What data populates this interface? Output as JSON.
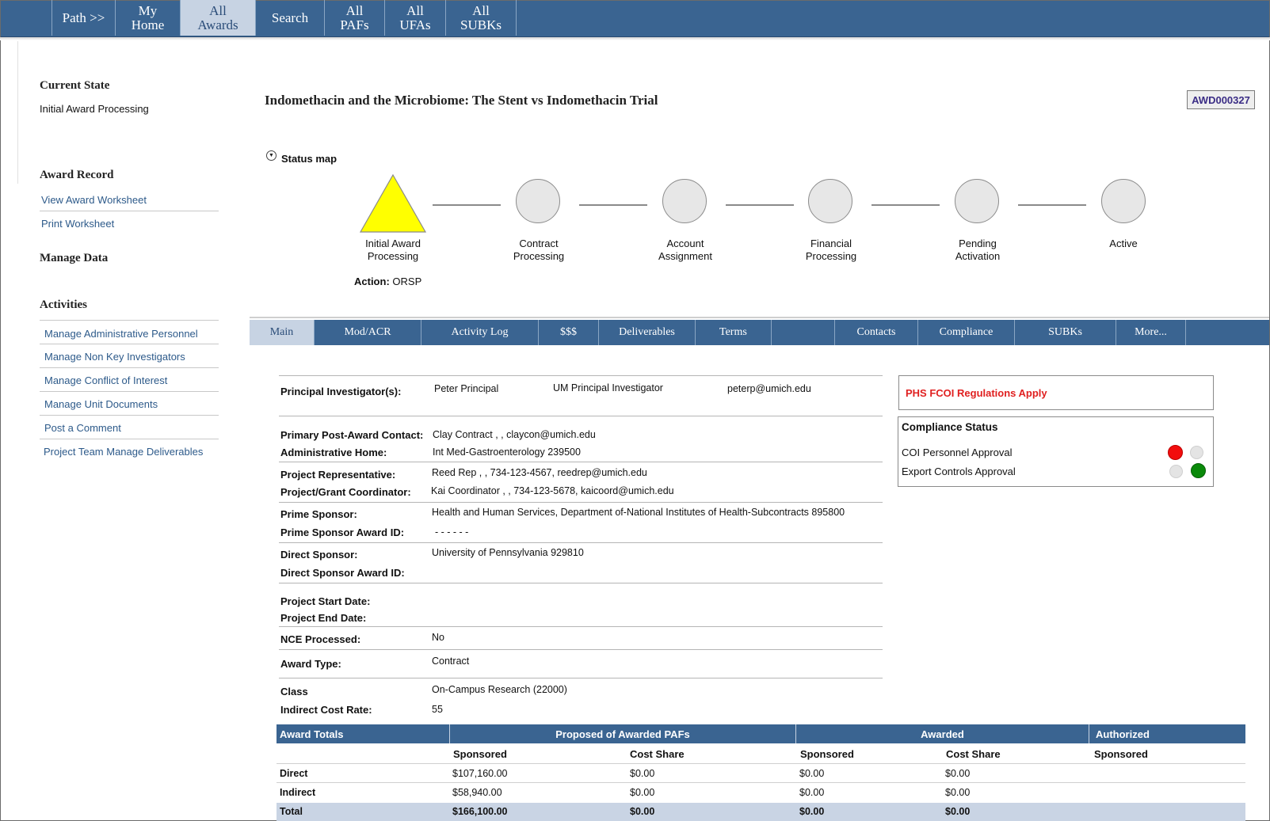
{
  "topnav": {
    "tabs": [
      {
        "label": "Path >>",
        "active": false
      },
      {
        "label": "My\nHome",
        "active": false
      },
      {
        "label": "All\nAwards",
        "active": true
      },
      {
        "label": "Search",
        "active": false
      },
      {
        "label": "All\nPAFs",
        "active": false
      },
      {
        "label": "All\nUFAs",
        "active": false
      },
      {
        "label": "All\nSUBKs",
        "active": false
      }
    ]
  },
  "sidebar": {
    "current_state_heading": "Current State",
    "current_state_value": "Initial Award Processing",
    "award_record_heading": "Award Record",
    "award_record_links": [
      "View Award Worksheet",
      "Print Worksheet"
    ],
    "manage_data_heading": "Manage Data",
    "activities_heading": "Activities",
    "activities_links": [
      "Manage Administrative Personnel",
      "Manage Non Key Investigators",
      "Manage Conflict of Interest",
      "Manage Unit Documents",
      "Post a Comment",
      "Project Team Manage Deliverables"
    ]
  },
  "header": {
    "title": "Indomethacin and the Microbiome: The Stent vs Indomethacin Trial",
    "award_id": "AWD000327"
  },
  "status_map": {
    "label": "Status map",
    "steps": [
      {
        "label": "Initial Award\nProcessing",
        "current": true
      },
      {
        "label": "Contract\nProcessing",
        "current": false
      },
      {
        "label": "Account\nAssignment",
        "current": false
      },
      {
        "label": "Financial\nProcessing",
        "current": false
      },
      {
        "label": "Pending\nActivation",
        "current": false
      },
      {
        "label": "Active",
        "current": false
      }
    ],
    "current_color": "#ffff00",
    "action_label": "Action:",
    "action_value": "ORSP"
  },
  "tabs": [
    "Main",
    "Mod/ACR",
    "Activity Log",
    "$$$",
    "Deliverables",
    "Terms",
    "Contacts",
    "Compliance",
    "SUBKs",
    "More..."
  ],
  "active_tab": "Main",
  "main": {
    "pi_label": "Principal Investigator(s):",
    "pi_name": "Peter Principal",
    "pi_role": "UM Principal Investigator",
    "pi_email": "peterp@umich.edu",
    "post_award_label": "Primary Post-Award Contact:",
    "post_award_value": "Clay Contract  ,  ,  claycon@umich.edu",
    "admin_home_label": "Administrative Home:",
    "admin_home_value": "Int Med-Gastroenterology   239500",
    "proj_rep_label": "Project Representative:",
    "proj_rep_value": "Reed Rep  ,  ,  734-123-4567,   reedrep@umich.edu",
    "proj_coord_label": "Project/Grant Coordinator:",
    "proj_coord_value": "Kai Coordinator  ,  ,  734-123-5678,   kaicoord@umich.edu",
    "prime_sponsor_label": "Prime Sponsor:",
    "prime_sponsor_value": "Health and Human Services, Department of-National Institutes of Health-Subcontracts   895800",
    "prime_award_id_label": "Prime Sponsor Award ID:",
    "prime_award_id_value": "-  -  -  -  -  -",
    "direct_sponsor_label": "Direct Sponsor:",
    "direct_sponsor_value": "University of Pennsylvania   929810",
    "direct_award_id_label": "Direct Sponsor Award ID:",
    "start_date_label": "Project Start Date:",
    "end_date_label": "Project End Date:",
    "nce_label": "NCE Processed:",
    "nce_value": "No",
    "award_type_label": "Award Type:",
    "award_type_value": "Contract",
    "class_label": "Class",
    "class_value": "On-Campus Research (22000)",
    "icr_label": "Indirect Cost Rate:",
    "icr_value": "55"
  },
  "compliance": {
    "fcoi_notice": "PHS FCOI Regulations Apply",
    "status_title": "Compliance Status",
    "items": [
      {
        "label": "COI Personnel Approval",
        "status": "red"
      },
      {
        "label": "Export Controls Approval",
        "status": "green"
      }
    ],
    "colors": {
      "red": "#f20d0d",
      "green": "#0a8a0a"
    }
  },
  "award_totals": {
    "header": [
      "Award Totals",
      "Proposed of Awarded PAFs",
      "Awarded",
      "Authorized"
    ],
    "subheader": [
      "",
      "Sponsored",
      "Cost Share",
      "Sponsored",
      "Cost Share",
      "Sponsored"
    ],
    "rows": [
      {
        "label": "Direct",
        "cells": [
          "$107,160.00",
          "$0.00",
          "$0.00",
          "$0.00",
          ""
        ]
      },
      {
        "label": "Indirect",
        "cells": [
          "$58,940.00",
          "$0.00",
          "$0.00",
          "$0.00",
          ""
        ]
      },
      {
        "label": "Total",
        "cells": [
          "$166,100.00",
          "$0.00",
          "$0.00",
          "$0.00",
          ""
        ]
      }
    ]
  },
  "theme": {
    "nav_blue": "#3a6491",
    "active_tab_bg": "#c7d3e3",
    "link_color": "#2d5a8a"
  }
}
